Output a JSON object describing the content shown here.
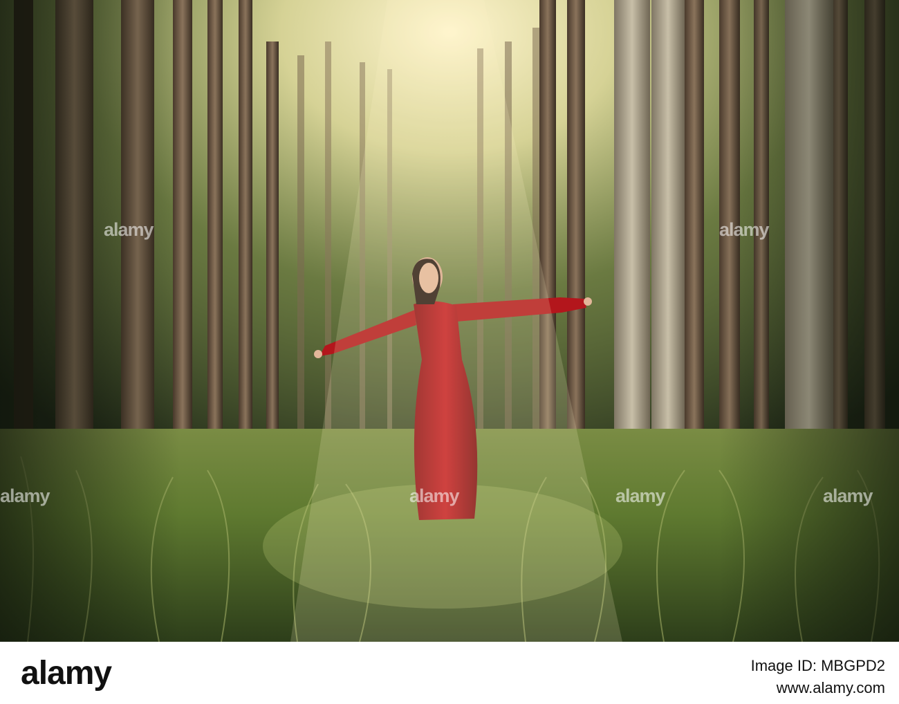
{
  "photo": {
    "subject": "woman-red-dress",
    "colors": {
      "dress": "#b3161c",
      "grass": "#6f8a3c",
      "trunk": "#6e5a45",
      "light": "#fff6d8"
    }
  },
  "watermark": {
    "text": "alamy"
  },
  "footer": {
    "logo": "alamy",
    "credit": "Image ID: MBGPD2",
    "image_id": "MBGPD2",
    "site": "www.alamy.com"
  }
}
